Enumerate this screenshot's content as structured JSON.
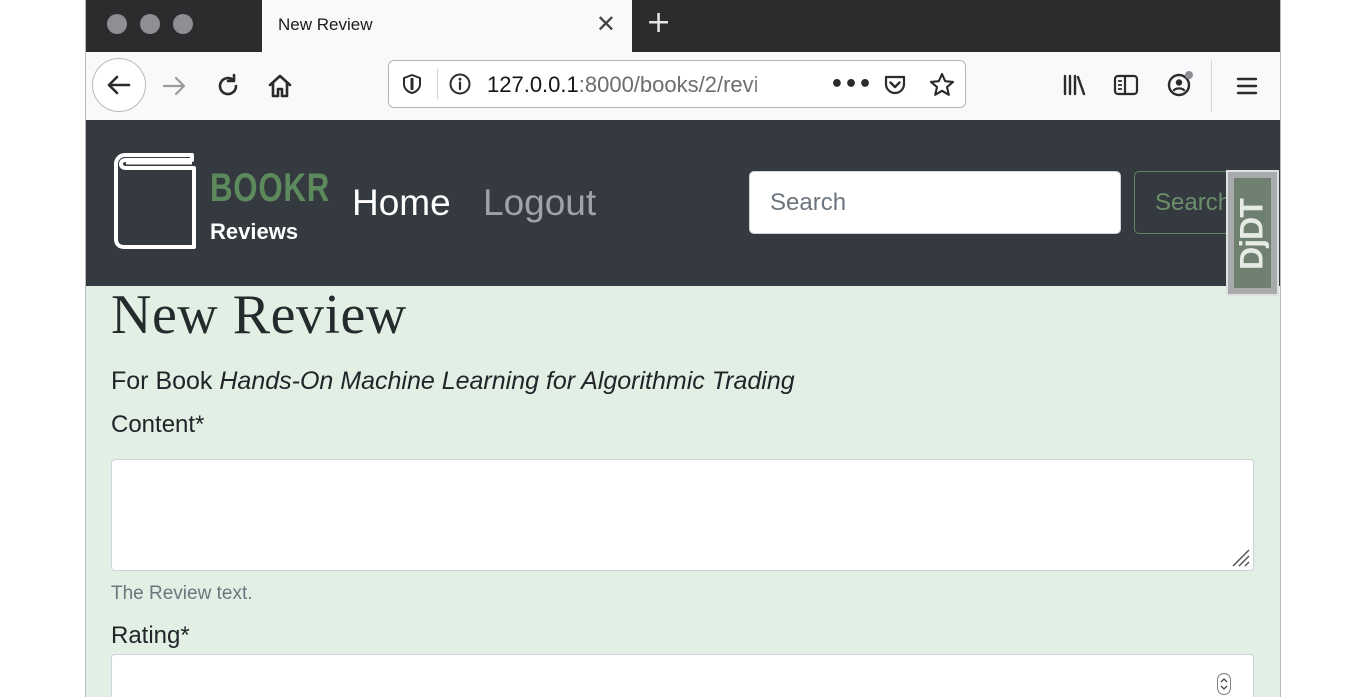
{
  "browser": {
    "tab_title": "New Review",
    "tab_close": "✕",
    "new_tab": "+",
    "url_host": "127.0.0.1",
    "url_path": ":8000/books/2/revi",
    "url_more": "•••"
  },
  "site": {
    "brand_name": "BOOKR",
    "brand_sub": "Reviews",
    "nav_home": "Home",
    "nav_logout": "Logout",
    "search_placeholder": "Search",
    "search_button": "Search",
    "debug_toolbar": "DjDT"
  },
  "form": {
    "page_title": "New Review",
    "for_book_prefix": "For Book ",
    "book_title": "Hands-On Machine Learning for Algorithmic Trading",
    "content_label": "Content*",
    "content_value": "",
    "content_help": "The Review text.",
    "rating_label": "Rating*",
    "rating_value": ""
  },
  "colors": {
    "navbar_bg": "#343a40",
    "brand_green": "#5d8a5c",
    "page_bg": "#e2efe4"
  }
}
